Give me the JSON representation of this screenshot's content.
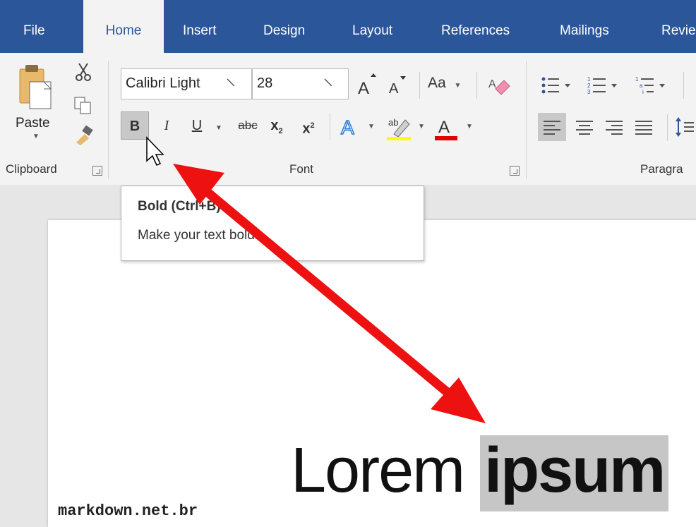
{
  "tabs": [
    "File",
    "Home",
    "Insert",
    "Design",
    "Layout",
    "References",
    "Mailings",
    "Revie"
  ],
  "active_tab": "Home",
  "clipboard": {
    "paste_label": "Paste",
    "group_label": "Clipboard"
  },
  "font": {
    "family": "Calibri Light",
    "size": "28",
    "change_case_label": "Aa",
    "bold": "B",
    "italic": "I",
    "underline": "U",
    "strike": "abc",
    "subscript": "x",
    "superscript": "x",
    "group_label": "Font"
  },
  "paragraph": {
    "group_label": "Paragra"
  },
  "tooltip": {
    "title": "Bold (Ctrl+B)",
    "description": "Make your text bold."
  },
  "document": {
    "text_normal": "Lorem",
    "text_selected": "ipsum"
  },
  "watermark": "markdown.net.br",
  "colors": {
    "ribbon_blue": "#2b579a",
    "arrow_red": "#ee1111",
    "highlight_yellow": "#ffff00",
    "font_red": "#e00000"
  }
}
